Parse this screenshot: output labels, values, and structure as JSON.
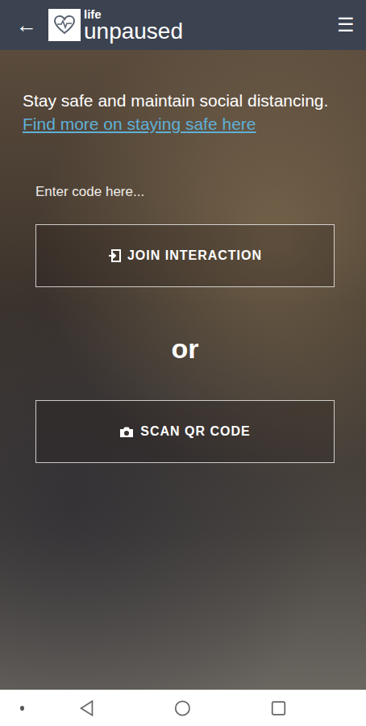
{
  "header": {
    "back": "←",
    "logo": {
      "top": "life",
      "bottom": "unpaused"
    },
    "menu": "☰"
  },
  "notice": {
    "text": "Stay safe and maintain social distancing.",
    "link": "Find more on staying safe here"
  },
  "code_input": {
    "placeholder": "Enter code here..."
  },
  "join_button": {
    "label": "JOIN INTERACTION"
  },
  "separator": "or",
  "scan_button": {
    "label": "SCAN QR CODE"
  }
}
